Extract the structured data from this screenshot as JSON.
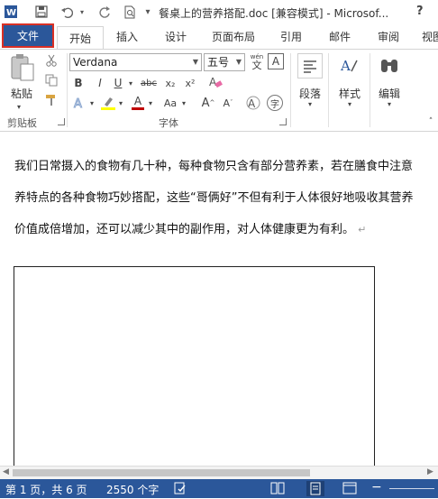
{
  "window": {
    "title": "餐桌上的营养搭配.doc [兼容模式] - Microsof...",
    "help_label": "?"
  },
  "tabs": [
    {
      "label": "文件"
    },
    {
      "label": "开始"
    },
    {
      "label": "插入"
    },
    {
      "label": "设计"
    },
    {
      "label": "页面布局"
    },
    {
      "label": "引用"
    },
    {
      "label": "邮件"
    },
    {
      "label": "审阅"
    },
    {
      "label": "视图"
    }
  ],
  "ribbon": {
    "clipboard": {
      "paste_label": "粘贴",
      "group_label": "剪贴板"
    },
    "font": {
      "font_name": "Verdana",
      "font_size": "五号",
      "wen_glyph": "wén",
      "wen_char": "文",
      "char_border": "A",
      "bold": "B",
      "italic": "I",
      "underline": "U",
      "strike": "abc",
      "subscript": "x₂",
      "superscript": "x²",
      "font_color": "A",
      "change_case": "Aa",
      "grow": "A",
      "shrink": "A",
      "enclose": "字",
      "clear_format": "A",
      "group_label": "字体"
    },
    "paragraph": {
      "label": "段落"
    },
    "styles": {
      "label": "样式"
    },
    "editing": {
      "label": "编辑"
    }
  },
  "document": {
    "lines": [
      "我们日常摄入的食物有几十种，每种食物只含有部分营养素，若在膳食中注意",
      "养特点的各种食物巧妙搭配，这些“哥俩好”不但有利于人体很好地吸收其营养",
      "价值成倍增加，还可以减少其中的副作用，对人体健康更为有利。"
    ],
    "paragraph_mark": "↵"
  },
  "status": {
    "page": "第 1 页，共 6 页",
    "words": "2550 个字"
  },
  "colors": {
    "accent": "#2b579a",
    "file_tab_outline": "#d93025",
    "highlight": "#ffff00",
    "font_color_bar": "#c00000"
  }
}
